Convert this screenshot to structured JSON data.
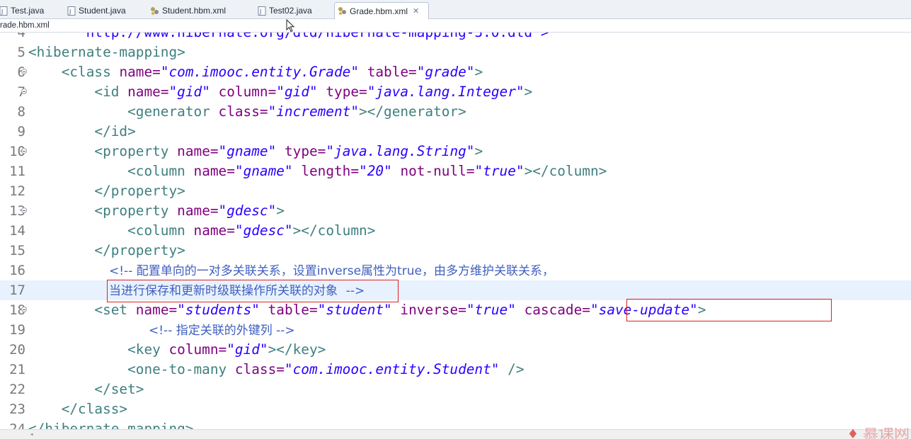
{
  "tabs": [
    {
      "label": "Test.java",
      "icon": "java-file-icon",
      "active": false
    },
    {
      "label": "Student.java",
      "icon": "java-file-icon",
      "active": false
    },
    {
      "label": "Student.hbm.xml",
      "icon": "hibernate-xml-icon",
      "active": false
    },
    {
      "label": "Test02.java",
      "icon": "java-file-icon",
      "active": false
    },
    {
      "label": "Grade.hbm.xml",
      "icon": "hibernate-xml-icon",
      "active": true,
      "close": "✕"
    }
  ],
  "breadcrumb": "rade.hbm.xml",
  "editor": {
    "lines": [
      {
        "n": "4",
        "top_partial": "\"http://www.hibernate.org/dtd/hibernate-mapping-3.0.dtd\">"
      },
      {
        "n": "5"
      },
      {
        "n": "6"
      },
      {
        "n": "7"
      },
      {
        "n": "8"
      },
      {
        "n": "9"
      },
      {
        "n": "10"
      },
      {
        "n": "11"
      },
      {
        "n": "12"
      },
      {
        "n": "13"
      },
      {
        "n": "14"
      },
      {
        "n": "15"
      },
      {
        "n": "16"
      },
      {
        "n": "17"
      },
      {
        "n": "18"
      },
      {
        "n": "19"
      },
      {
        "n": "20"
      },
      {
        "n": "21"
      },
      {
        "n": "22"
      },
      {
        "n": "23"
      },
      {
        "n": "24"
      }
    ],
    "text": {
      "l5_tag": "<hibernate-mapping>",
      "l6_open": "<class",
      "l6_a1": "name=",
      "l6_v1": "\"com.imooc.entity.Grade\"",
      "l6_a2": "table=",
      "l6_v2": "\"grade\"",
      "l6_close": ">",
      "l7_open": "<id",
      "l7_a1": "name=",
      "l7_v1": "\"gid\"",
      "l7_a2": "column=",
      "l7_v2": "\"gid\"",
      "l7_a3": "type=",
      "l7_v3": "\"java.lang.Integer\"",
      "l7_close": ">",
      "l8_open": "<generator",
      "l8_a1": "class=",
      "l8_v1": "\"increment\"",
      "l8_close": "></generator>",
      "l9_tag": "</id>",
      "l10_open": "<property",
      "l10_a1": "name=",
      "l10_v1": "\"gname\"",
      "l10_a2": "type=",
      "l10_v2": "\"java.lang.String\"",
      "l10_close": ">",
      "l11_open": "<column",
      "l11_a1": "name=",
      "l11_v1": "\"gname\"",
      "l11_a2": "length=",
      "l11_v2": "\"20\"",
      "l11_a3": "not-null=",
      "l11_v3": "\"true\"",
      "l11_close": "></column>",
      "l12_tag": "</property>",
      "l13_open": "<property",
      "l13_a1": "name=",
      "l13_v1": "\"gdesc\"",
      "l13_close": ">",
      "l14_open": "<column",
      "l14_a1": "name=",
      "l14_v1": "\"gdesc\"",
      "l14_close": "></column>",
      "l15_tag": "</property>",
      "l16_comment": "<!-- 配置单向的一对多关联关系，设置inverse属性为true，由多方维护关联关系，",
      "l17_comment": "当进行保存和更新时级联操作所关联的对象",
      "l17_end": "-->",
      "l18_open": "<set",
      "l18_a1": "name=",
      "l18_v1": "\"students\"",
      "l18_a2": "table=",
      "l18_v2": "\"student\"",
      "l18_a3": "inverse=",
      "l18_v3": "\"true\"",
      "l18_a4": "cascade=",
      "l18_v4": "\"save-update\"",
      "l18_close": ">",
      "l19_comment": "<!-- 指定关联的外键列 -->",
      "l20_open": "<key",
      "l20_a1": "column=",
      "l20_v1": "\"gid\"",
      "l20_close": "></key>",
      "l21_open": "<one-to-many",
      "l21_a1": "class=",
      "l21_v1": "\"com.imooc.entity.Student\"",
      "l21_close": "/>",
      "l22_tag": "</set>",
      "l23_tag": "</class>",
      "l24_partial": "</hibernate-mapping>"
    }
  },
  "watermark": "慕课网",
  "colors": {
    "tag": "#3f7f7f",
    "attr": "#7f007f",
    "value": "#2a00ff",
    "comment": "#3f5fbf",
    "highlight_box": "#e02020",
    "current_line": "#e8f2fe"
  }
}
